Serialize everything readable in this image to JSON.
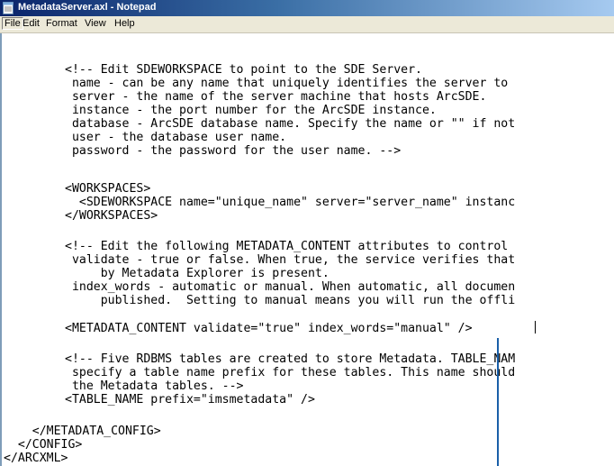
{
  "window": {
    "title": "MetadataServer.axl - Notepad",
    "icon": "notepad-icon",
    "titlebar_color": "#0a246a"
  },
  "menu": {
    "items": [
      "File",
      "Edit",
      "Format",
      "View",
      "Help"
    ]
  },
  "editor": {
    "lines": [
      "<!-- Edit SDEWORKSPACE to point to the SDE Server.",
      " name - can be any name that uniquely identifies the server to ",
      " server - the name of the server machine that hosts ArcSDE.",
      " instance - the port number for the ArcSDE instance.",
      " database - ArcSDE database name. Specify the name or \"\" if not",
      " user - the database user name.",
      " password - the password for the user name. -->",
      "<WORKSPACES>",
      "  <SDEWORKSPACE name=\"unique_name\" server=\"server_name\" instanc",
      "</WORKSPACES>",
      "<!-- Edit the following METADATA_CONTENT attributes to control ",
      " validate - true or false. When true, the service verifies that",
      "     by Metadata Explorer is present.",
      " index_words - automatic or manual. When automatic, all documen",
      "     published.  Setting to manual means you will run the offli",
      "<METADATA_CONTENT validate=\"true\" index_words=\"manual\" />",
      "<!-- Five RDBMS tables are created to store Metadata. TABLE_NAM",
      " specify a table name prefix for these tables. This name should",
      " the Metadata tables. -->",
      "<TABLE_NAME prefix=\"imsmetadata\" />",
      "    </METADATA_CONFIG>",
      "  </CONFIG>",
      "</ARCXML>"
    ]
  },
  "callout_color": "#1a5fa8"
}
